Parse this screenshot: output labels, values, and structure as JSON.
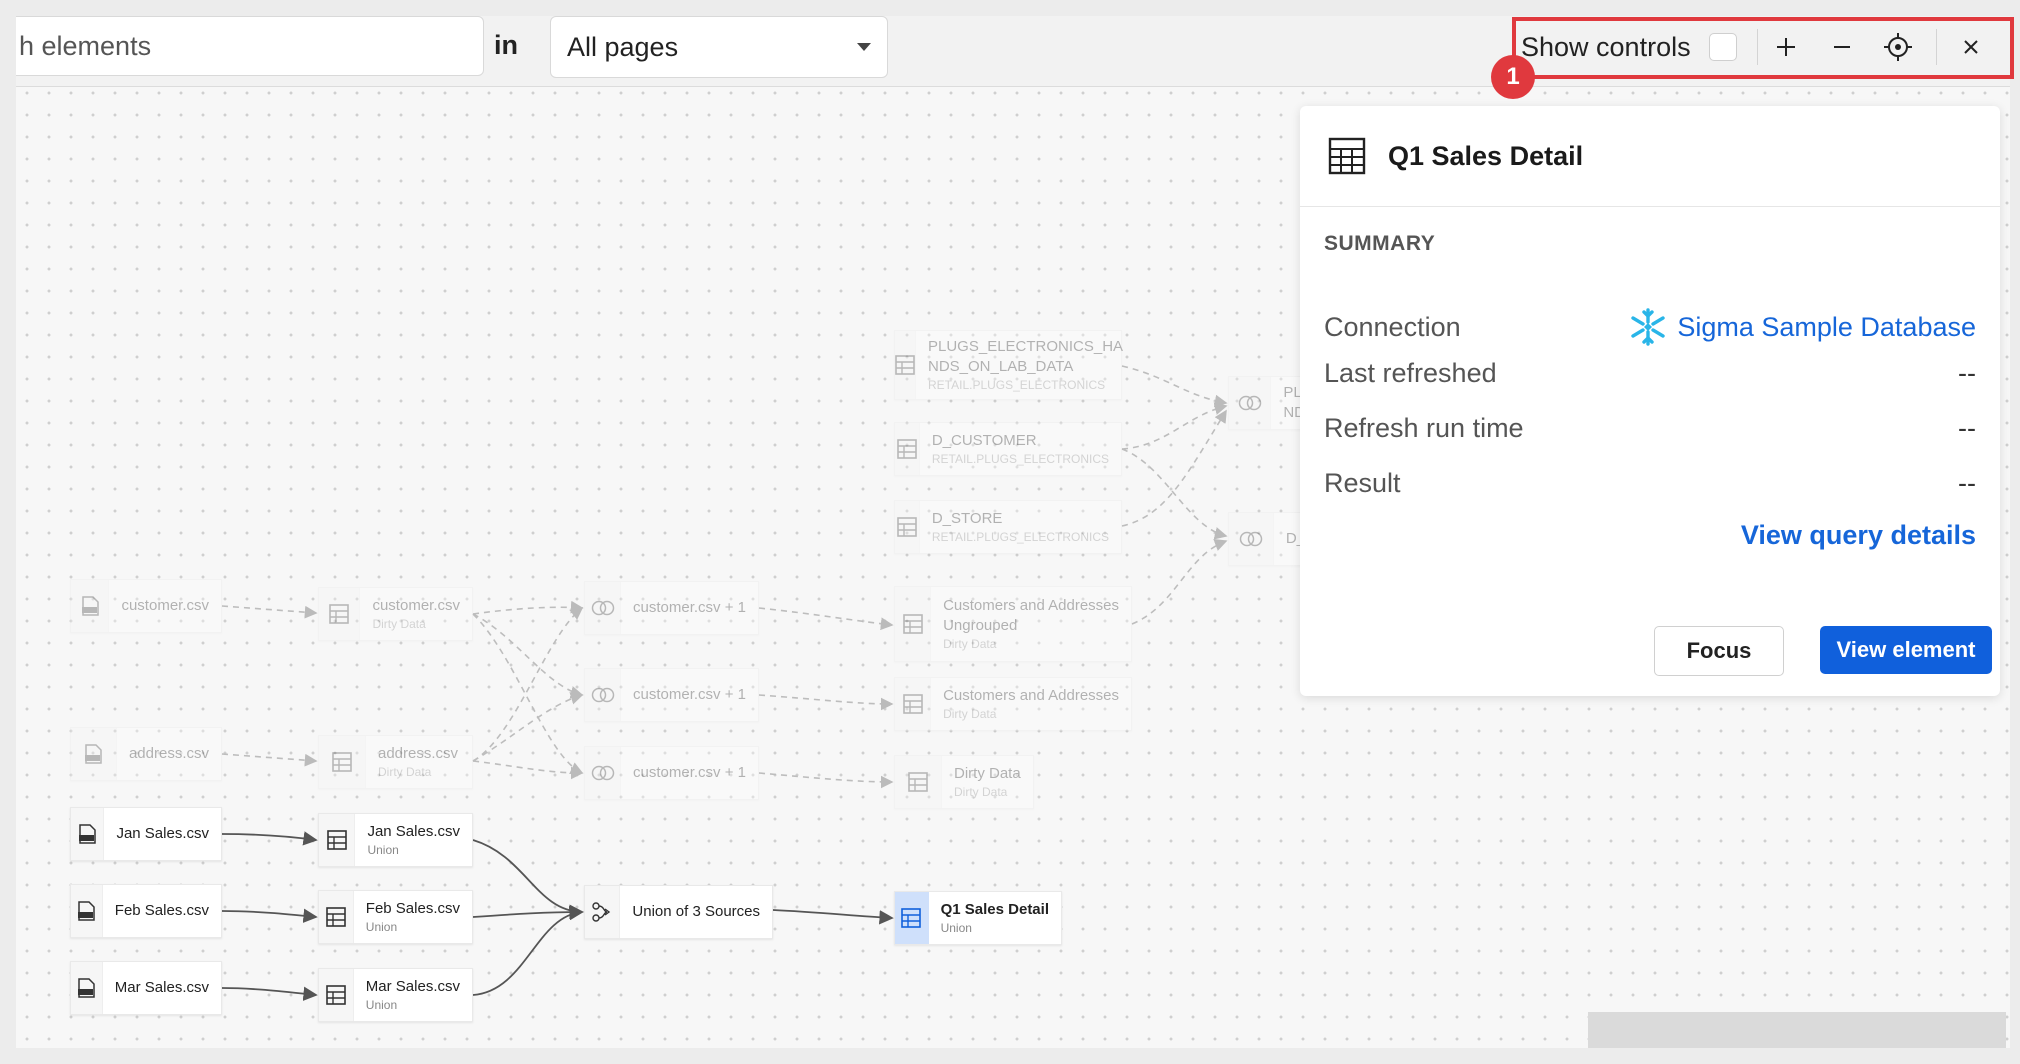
{
  "toolbar": {
    "search_placeholder": "h elements",
    "in_label": "in",
    "page_select": "All pages",
    "show_controls": "Show controls",
    "badge": "1"
  },
  "nodes": {
    "plugs": {
      "title": "PLUGS_ELECTRONICS_HA",
      "title2": "NDS_ON_LAB_DATA",
      "sub": "RETAIL.PLUGS_ELECTRONICS"
    },
    "d_customer": {
      "title": "D_CUSTOMER",
      "sub": "RETAIL.PLUGS_ELECTRONICS"
    },
    "d_store": {
      "title": "D_STORE",
      "sub": "RETAIL.PLUGS_ELECTRONICS"
    },
    "join_top": {
      "title": "PL",
      "title2": "ND"
    },
    "join_mid": {
      "title": "D_"
    },
    "customer_csv": {
      "title": "customer.csv"
    },
    "customer_dirty": {
      "title": "customer.csv",
      "sub": "Dirty Data"
    },
    "join_cust1": {
      "title": "customer.csv + 1"
    },
    "join_cust2": {
      "title": "customer.csv + 1"
    },
    "join_cust3": {
      "title": "customer.csv + 1"
    },
    "cust_addr_ungrouped": {
      "title": "Customers and Addresses",
      "title2": "Ungrouped",
      "sub": "Dirty Data"
    },
    "cust_addr": {
      "title": "Customers and Addresses",
      "sub": "Dirty Data"
    },
    "dirty_data": {
      "title": "Dirty Data",
      "sub": "Dirty Data"
    },
    "address_csv": {
      "title": "address.csv"
    },
    "address_dirty": {
      "title": "address.csv",
      "sub": "Dirty Data"
    },
    "jan_csv": {
      "title": "Jan Sales.csv"
    },
    "jan_union": {
      "title": "Jan Sales.csv",
      "sub": "Union"
    },
    "feb_csv": {
      "title": "Feb Sales.csv"
    },
    "feb_union": {
      "title": "Feb Sales.csv",
      "sub": "Union"
    },
    "mar_csv": {
      "title": "Mar Sales.csv"
    },
    "mar_union": {
      "title": "Mar Sales.csv",
      "sub": "Union"
    },
    "union3": {
      "title": "Union of 3 Sources"
    },
    "q1": {
      "title": "Q1 Sales Detail",
      "sub": "Union"
    }
  },
  "panel": {
    "title": "Q1 Sales Detail",
    "summary": "SUMMARY",
    "connection_label": "Connection",
    "connection_value": "Sigma Sample Database",
    "last_refreshed_label": "Last refreshed",
    "last_refreshed_value": "--",
    "refresh_time_label": "Refresh run time",
    "refresh_time_value": "--",
    "result_label": "Result",
    "result_value": "--",
    "view_query": "View query details",
    "focus": "Focus",
    "view_element": "View element"
  },
  "colors": {
    "accent": "#1060dc",
    "link": "#1666d9",
    "highlight": "#e0393e",
    "snowflake": "#29b5e8"
  }
}
